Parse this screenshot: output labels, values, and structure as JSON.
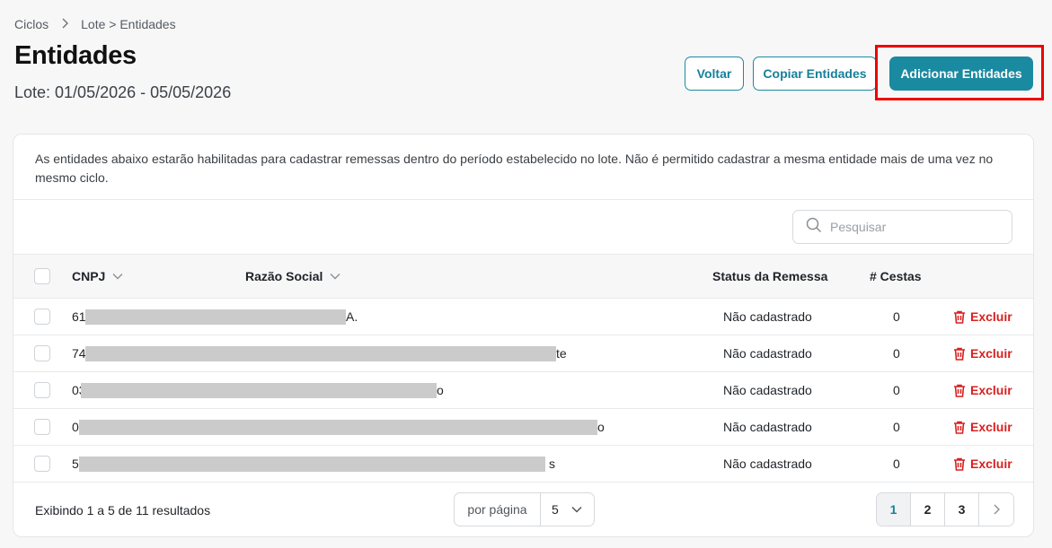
{
  "breadcrumb": {
    "root": "Ciclos",
    "path": "Lote > Entidades"
  },
  "header": {
    "title": "Entidades",
    "subtitle": "Lote: 01/05/2026 - 05/05/2026",
    "back_label": "Voltar",
    "copy_label": "Copiar Entidades",
    "add_label": "Adicionar Entidades"
  },
  "info_text": "As entidades abaixo estarão habilitadas para cadastrar remessas dentro do período estabelecido no lote. Não é permitido cadastrar a mesma entidade mais de uma vez no mesmo ciclo.",
  "search": {
    "placeholder": "Pesquisar"
  },
  "table": {
    "columns": {
      "cnpj": "CNPJ",
      "razao": "Razão Social",
      "status": "Status da Remessa",
      "cestas": "# Cestas"
    },
    "rows": [
      {
        "cnpj_prefix": "61",
        "name_suffix": "A.",
        "status": "Não cadastrado",
        "cestas": "0",
        "action": "Excluir"
      },
      {
        "cnpj_prefix": "74",
        "name_suffix": "te",
        "status": "Não cadastrado",
        "cestas": "0",
        "action": "Excluir"
      },
      {
        "cnpj_prefix": "03",
        "name_suffix": "o",
        "status": "Não cadastrado",
        "cestas": "0",
        "action": "Excluir"
      },
      {
        "cnpj_prefix": "0",
        "name_suffix": "o",
        "status": "Não cadastrado",
        "cestas": "0",
        "action": "Excluir"
      },
      {
        "cnpj_prefix": "5",
        "name_suffix": "s",
        "status": "Não cadastrado",
        "cestas": "0",
        "action": "Excluir"
      }
    ]
  },
  "footer": {
    "summary": "Exibindo 1 a 5 de 11 resultados",
    "per_page_label": "por página",
    "per_page_value": "5",
    "pages": [
      "1",
      "2",
      "3"
    ],
    "current_page": "1"
  },
  "colors": {
    "accent": "#1a8aa1",
    "danger": "#d92020",
    "highlight": "#ee0000"
  },
  "icons": {
    "breadcrumb_sep": "chevron-right-icon",
    "search": "search-icon",
    "delete": "trash-icon",
    "sort": "chevron-down-icon",
    "next": "chevron-right-icon"
  }
}
